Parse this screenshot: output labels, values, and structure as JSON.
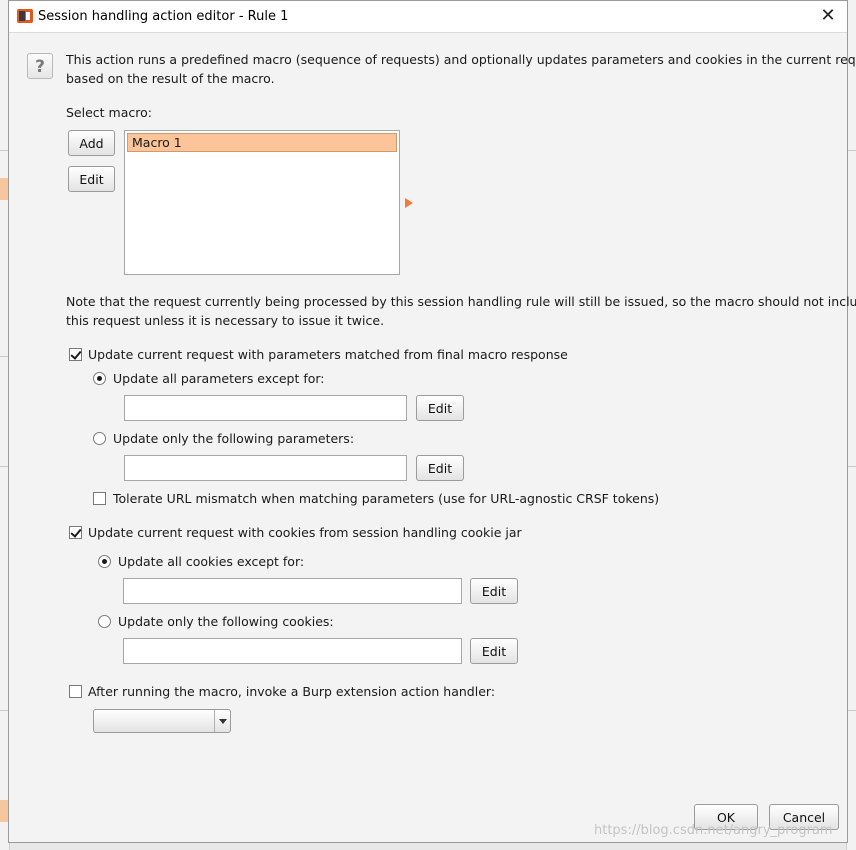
{
  "window": {
    "title": "Session handling action editor - Rule 1",
    "close_label": "✕"
  },
  "help": {
    "icon_glyph": "?",
    "description_line1": "This action runs a predefined macro (sequence of requests) and optionally updates parameters and cookies in the current request",
    "description_line2": "based on the result of the macro."
  },
  "macro": {
    "label": "Select macro:",
    "add_label": "Add",
    "edit_label": "Edit",
    "items": [
      "Macro 1"
    ],
    "selected": "Macro 1"
  },
  "note": {
    "line1": "Note that the request currently being processed by this session handling rule will still be issued, so the macro should not include",
    "line2": "this request unless it is necessary to issue it twice."
  },
  "params": {
    "update_label": "Update current request with parameters matched from final macro response",
    "update_checked": true,
    "all_except_label": "Update all parameters except for:",
    "all_except_value": "",
    "only_following_label": "Update only the following parameters:",
    "only_following_value": "",
    "selected_mode": "all_except",
    "edit_label": "Edit",
    "tolerate_label": "Tolerate URL mismatch when matching parameters (use for URL-agnostic CRSF tokens)",
    "tolerate_checked": false
  },
  "cookies": {
    "update_label": "Update current request with cookies from session handling cookie jar",
    "update_checked": true,
    "all_except_label": "Update all cookies except for:",
    "all_except_value": "",
    "only_following_label": "Update only the following cookies:",
    "only_following_value": "",
    "selected_mode": "all_except",
    "edit_label": "Edit"
  },
  "extension": {
    "label": "After running the macro, invoke a Burp extension action handler:",
    "checked": false,
    "selected_value": ""
  },
  "footer": {
    "ok_label": "OK",
    "cancel_label": "Cancel",
    "watermark": "https://blog.csdn.net/angry_program"
  },
  "colors": {
    "selection": "#fbc599",
    "accent": "#f07a3a",
    "app_icon": "#e8551f"
  }
}
